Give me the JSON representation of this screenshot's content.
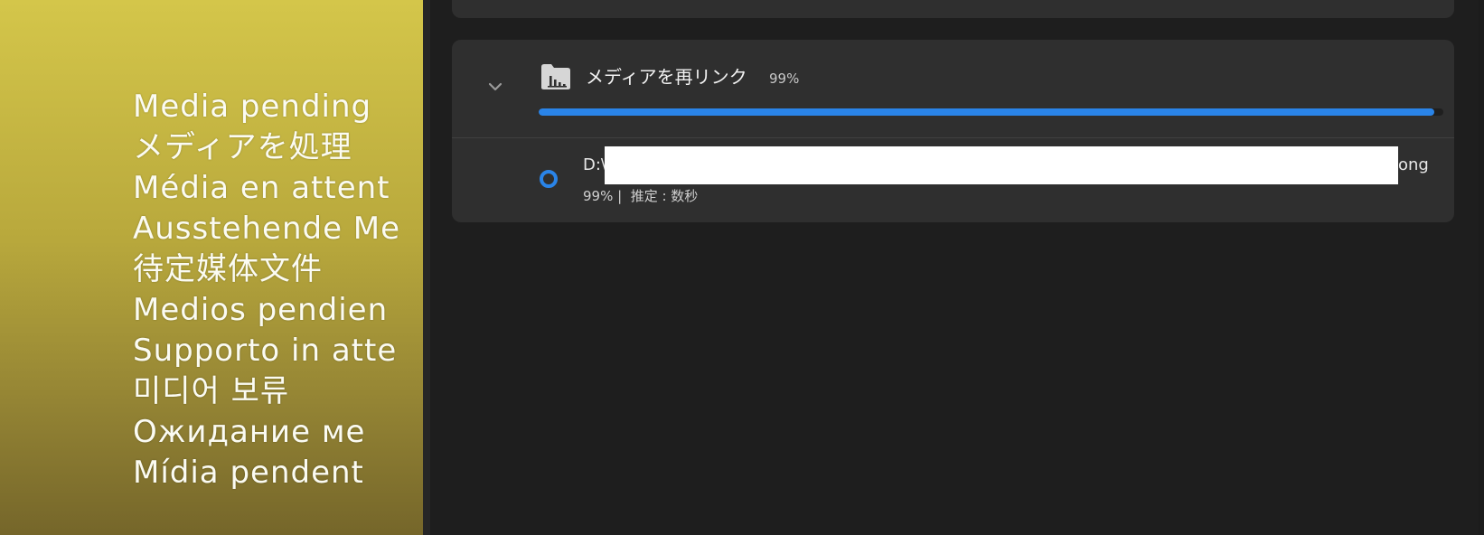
{
  "preview": {
    "lines": [
      "Media pending",
      "メディアを処理",
      "Média en attent",
      "Ausstehende Me",
      "待定媒体文件",
      "Medios pendien",
      "Supporto in atte",
      "미디어 보류",
      "Ожидание ме",
      "Mídia pendent"
    ]
  },
  "task": {
    "title": "メディアを再リンク",
    "percent_label": "99%",
    "progress": 0.99,
    "icon": "folder-chart-icon",
    "expand_icon": "chevron-down-icon",
    "progress_color": "#2a84e8"
  },
  "file": {
    "path_prefix": "D:\\",
    "path_suffix": "ong",
    "status": "99% |  推定 : 数秒",
    "spinner_icon": "spinner-icon",
    "spinner_color": "#2a84e8"
  }
}
